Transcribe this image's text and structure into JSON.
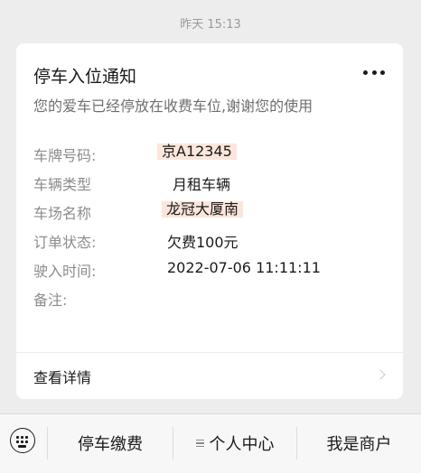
{
  "timestamp": "昨天 15:13",
  "card": {
    "title": "停车入位通知",
    "subtitle": "您的爱车已经停放在收费车位,谢谢您的使用",
    "fields": [
      {
        "label": "车牌号码:",
        "value": "京A12345"
      },
      {
        "label": "车辆类型",
        "value": "月租车辆"
      },
      {
        "label": "车场名称",
        "value": "龙冠大厦南"
      },
      {
        "label": "订单状态:",
        "value": "欠费100元"
      },
      {
        "label": "驶入时间:",
        "value": "2022-07-06 11:11:11"
      },
      {
        "label": "备注:",
        "value": ""
      }
    ],
    "detail_label": "查看详情"
  },
  "menu": {
    "items": [
      {
        "label": "停车缴费"
      },
      {
        "label": "个人中心"
      },
      {
        "label": "我是商户"
      }
    ]
  },
  "colors": {
    "highlight": "#fbe6dc",
    "background": "#ededed"
  },
  "icons": {
    "more": "more-dots-icon",
    "keyboard": "keyboard-icon",
    "submenu": "list-icon",
    "chevron": "chevron-right-icon"
  }
}
